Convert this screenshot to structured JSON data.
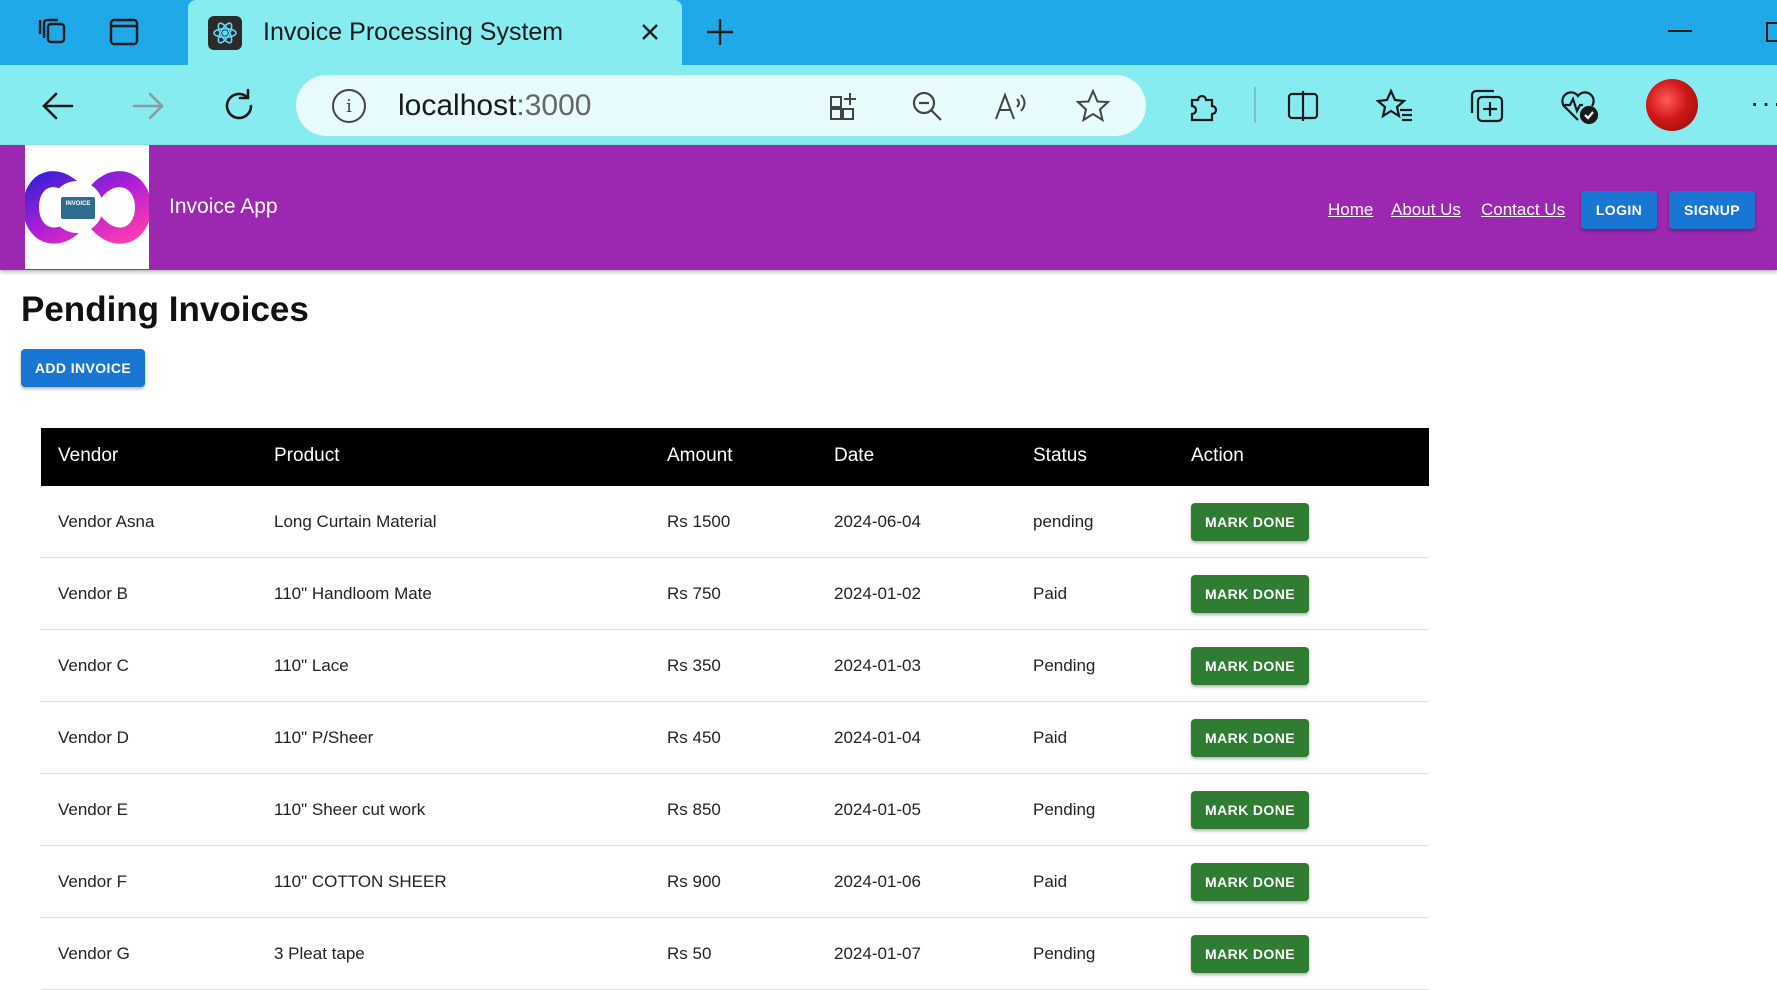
{
  "browser": {
    "tab_title": "Invoice Processing System",
    "url_host": "localhost",
    "url_port": ":3000"
  },
  "header": {
    "app_title": "Invoice App",
    "logo_text": "INVOICE",
    "nav": {
      "home": "Home",
      "about": "About Us",
      "contact": "Contact Us"
    },
    "login_label": "LOGIN",
    "signup_label": "SIGNUP"
  },
  "page": {
    "title": "Pending Invoices",
    "add_label": "ADD INVOICE"
  },
  "table": {
    "headers": {
      "vendor": "Vendor",
      "product": "Product",
      "amount": "Amount",
      "date": "Date",
      "status": "Status",
      "action": "Action"
    },
    "rows": [
      {
        "vendor": "Vendor Asna",
        "product": "Long Curtain Material",
        "amount": "Rs 1500",
        "date": "2024-06-04",
        "status": "pending",
        "action": "MARK DONE"
      },
      {
        "vendor": "Vendor B",
        "product": "110\" Handloom Mate",
        "amount": "Rs 750",
        "date": "2024-01-02",
        "status": "Paid",
        "action": "MARK DONE"
      },
      {
        "vendor": "Vendor C",
        "product": "110\" Lace",
        "amount": "Rs 350",
        "date": "2024-01-03",
        "status": "Pending",
        "action": "MARK DONE"
      },
      {
        "vendor": "Vendor D",
        "product": "110\" P/Sheer",
        "amount": "Rs 450",
        "date": "2024-01-04",
        "status": "Paid",
        "action": "MARK DONE"
      },
      {
        "vendor": "Vendor E",
        "product": "110\" Sheer cut work",
        "amount": "Rs 850",
        "date": "2024-01-05",
        "status": "Pending",
        "action": "MARK DONE"
      },
      {
        "vendor": "Vendor F",
        "product": "110\" COTTON SHEER",
        "amount": "Rs 900",
        "date": "2024-01-06",
        "status": "Paid",
        "action": "MARK DONE"
      },
      {
        "vendor": "Vendor G",
        "product": "3 Pleat tape",
        "amount": "Rs 50",
        "date": "2024-01-07",
        "status": "Pending",
        "action": "MARK DONE"
      }
    ]
  },
  "colors": {
    "appbar": "#9c27b0",
    "primary_button": "#1976d2",
    "success_button": "#2e7d32",
    "table_header": "#000000",
    "browser_tabbar": "#1fa9e8",
    "browser_toolbar": "#87ecf0"
  }
}
